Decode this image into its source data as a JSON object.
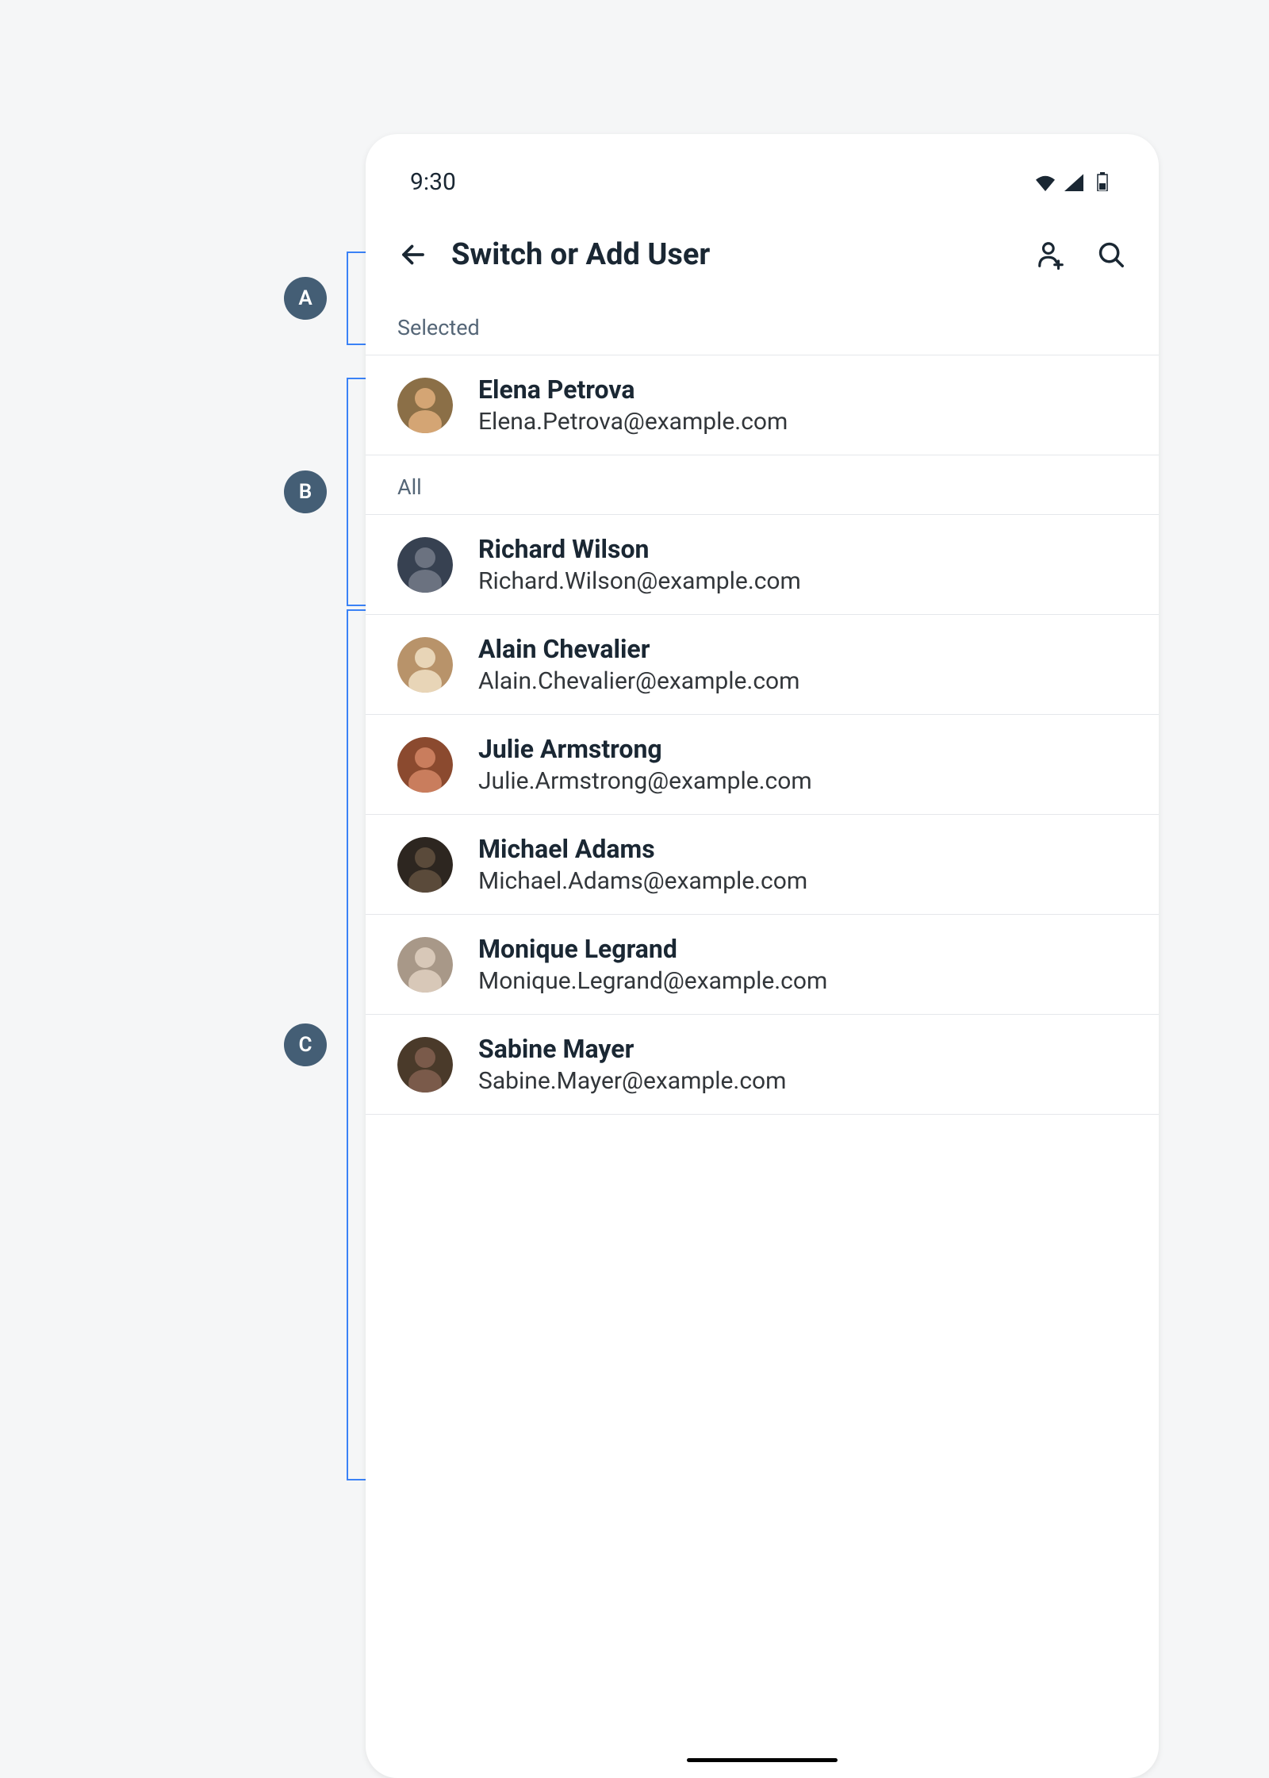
{
  "status_bar": {
    "time": "9:30"
  },
  "app_bar": {
    "title": "Switch or Add User"
  },
  "sections": {
    "selected": {
      "header": "Selected",
      "items": [
        {
          "name": "Elena Petrova",
          "email": "Elena.Petrova@example.com",
          "avatar_colors": [
            "#d4a574",
            "#8b6f47"
          ]
        }
      ]
    },
    "all": {
      "header": "All",
      "items": [
        {
          "name": "Richard Wilson",
          "email": "Richard.Wilson@example.com",
          "avatar_colors": [
            "#6b7280",
            "#374151"
          ]
        },
        {
          "name": "Alain Chevalier",
          "email": "Alain.Chevalier@example.com",
          "avatar_colors": [
            "#e8d5b7",
            "#b8936a"
          ]
        },
        {
          "name": "Julie Armstrong",
          "email": "Julie.Armstrong@example.com",
          "avatar_colors": [
            "#c97d5d",
            "#8b4a2f"
          ]
        },
        {
          "name": "Michael Adams",
          "email": "Michael.Adams@example.com",
          "avatar_colors": [
            "#5a4a3a",
            "#2d2620"
          ]
        },
        {
          "name": "Monique Legrand",
          "email": "Monique.Legrand@example.com",
          "avatar_colors": [
            "#d8c8b8",
            "#a89888"
          ]
        },
        {
          "name": "Sabine Mayer",
          "email": "Sabine.Mayer@example.com",
          "avatar_colors": [
            "#7a5a4a",
            "#4a3a2a"
          ]
        }
      ]
    }
  },
  "annotations": {
    "a": "A",
    "b": "B",
    "c": "C"
  }
}
